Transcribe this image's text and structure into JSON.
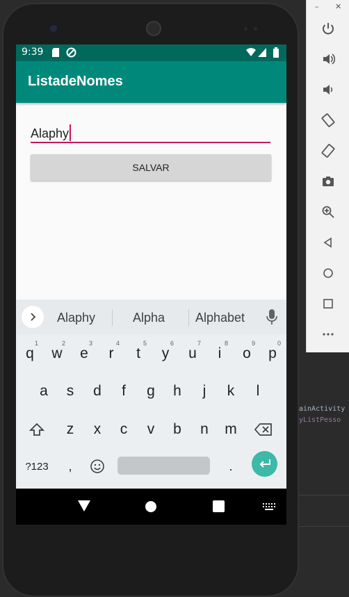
{
  "status": {
    "time": "9:39"
  },
  "app": {
    "title": "ListadeNomes"
  },
  "form": {
    "input_value": "Alaphy",
    "save_label": "SALVAR"
  },
  "keyboard": {
    "suggestions": [
      "Alaphy",
      "Alpha",
      "Alphabet"
    ],
    "row1": [
      "q",
      "w",
      "e",
      "r",
      "t",
      "y",
      "u",
      "i",
      "o",
      "p"
    ],
    "row1_hints": [
      "1",
      "2",
      "3",
      "4",
      "5",
      "6",
      "7",
      "8",
      "9",
      "0"
    ],
    "row2": [
      "a",
      "s",
      "d",
      "f",
      "g",
      "h",
      "j",
      "k",
      "l"
    ],
    "row3": [
      "z",
      "x",
      "c",
      "v",
      "b",
      "n",
      "m"
    ],
    "symbols_label": "?123",
    "comma": ",",
    "period": "."
  },
  "ide": {
    "code_lines": [
      "ainActivity",
      "yListPesso"
    ]
  },
  "colors": {
    "status_bar": "#00695c",
    "app_bar": "#00897b",
    "accent": "#c2185b",
    "enter_key": "#3eb8a8"
  }
}
